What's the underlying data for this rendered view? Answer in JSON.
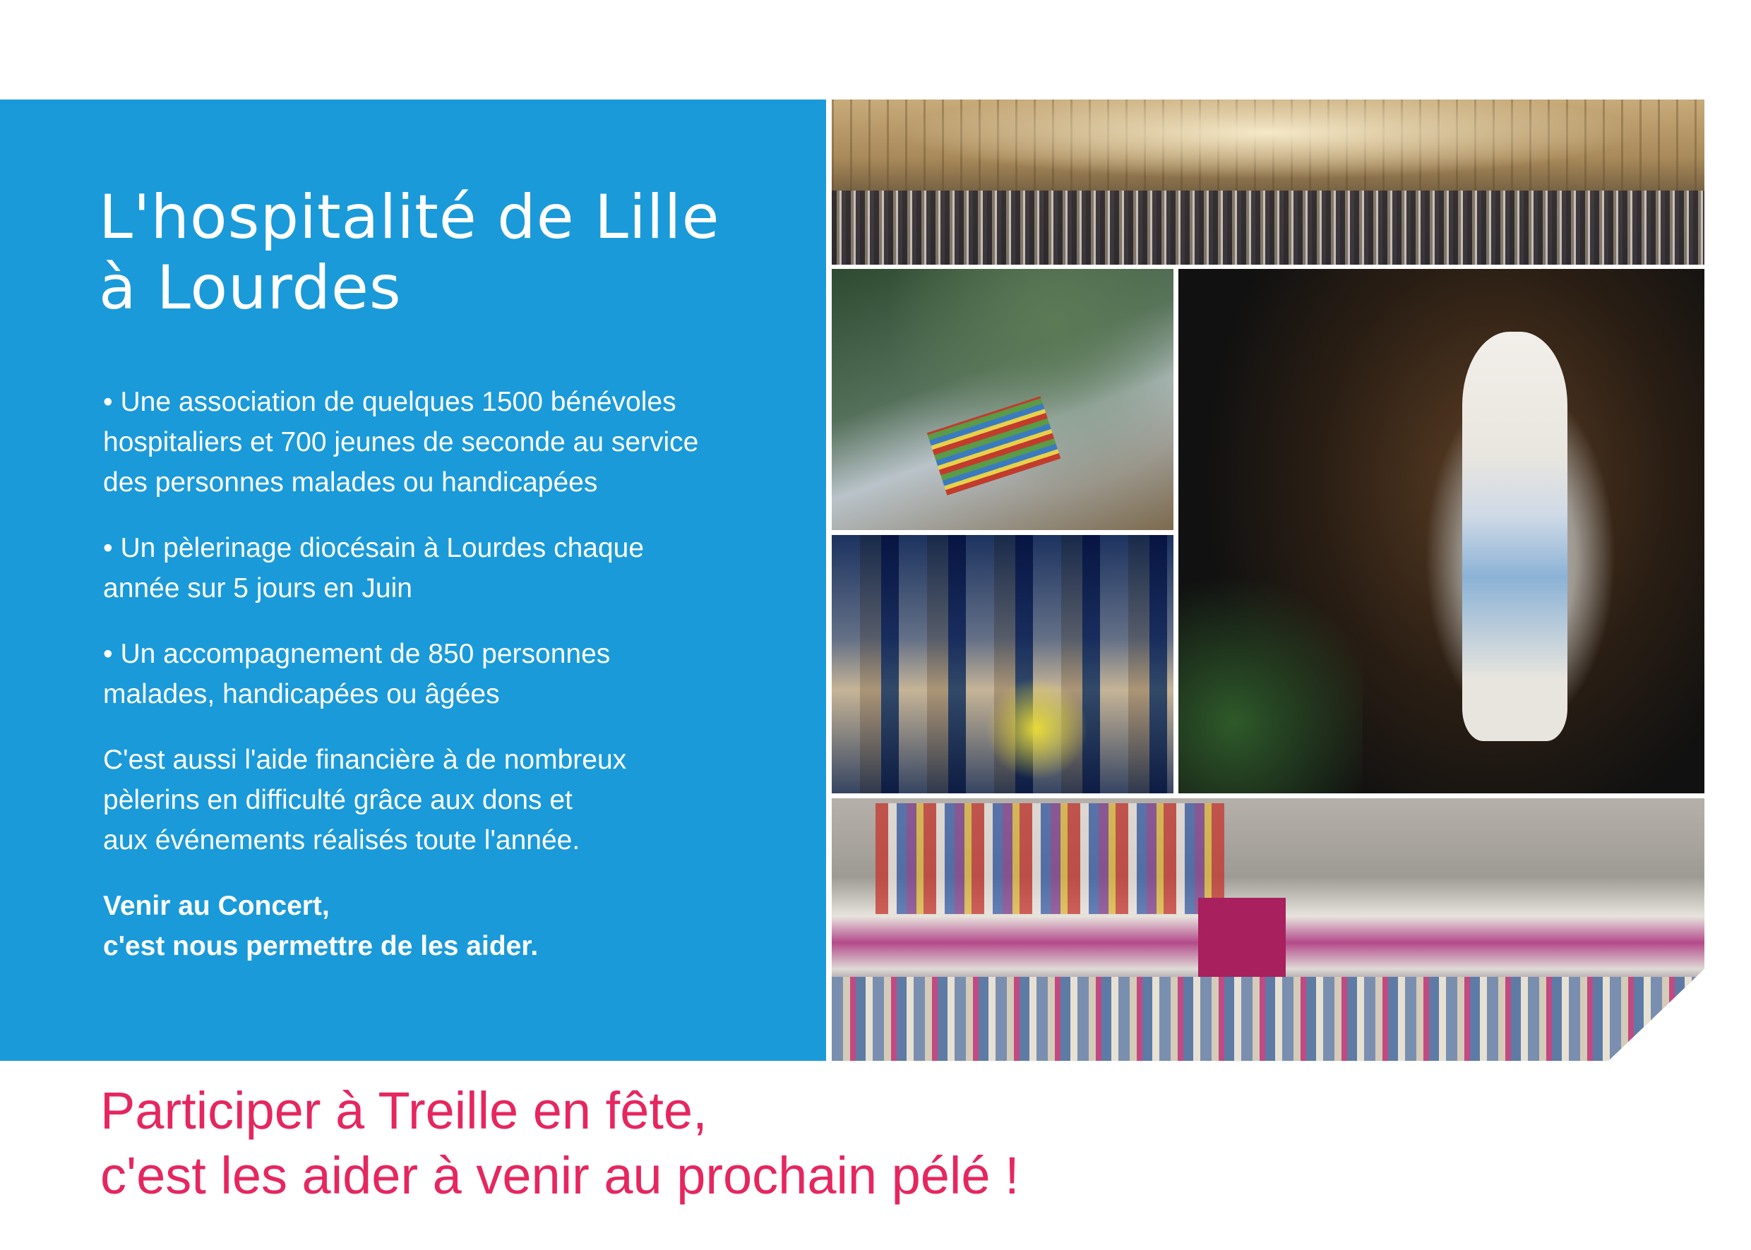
{
  "title": {
    "line1": "L'hospitalité de Lille",
    "line2": "à Lourdes"
  },
  "bullets": [
    {
      "lines": [
        "• Une association de quelques 1500 bénévoles",
        "hospitaliers et 700 jeunes de seconde au service",
        "des personnes malades ou handicapées"
      ]
    },
    {
      "lines": [
        "• Un pèlerinage diocésain à Lourdes chaque",
        "année sur 5 jours en Juin"
      ]
    },
    {
      "lines": [
        "• Un accompagnement de 850 personnes",
        "malades, handicapées ou âgées"
      ]
    }
  ],
  "aid_text": {
    "lines": [
      "C'est aussi l'aide financière à de nombreux",
      "pèlerins en difficulté grâce aux dons et",
      "aux événements réalisés toute l'année."
    ]
  },
  "concert_note": {
    "lines": [
      "Venir au Concert,",
      "c'est nous permettre de les aider."
    ]
  },
  "tagline": {
    "line1": "Participer à Treille en fête,",
    "line2": "c'est les aider à venir au prochain pélé !"
  },
  "colors": {
    "panel_blue": "#1a9ad9",
    "tagline_pink": "#e6265f"
  }
}
